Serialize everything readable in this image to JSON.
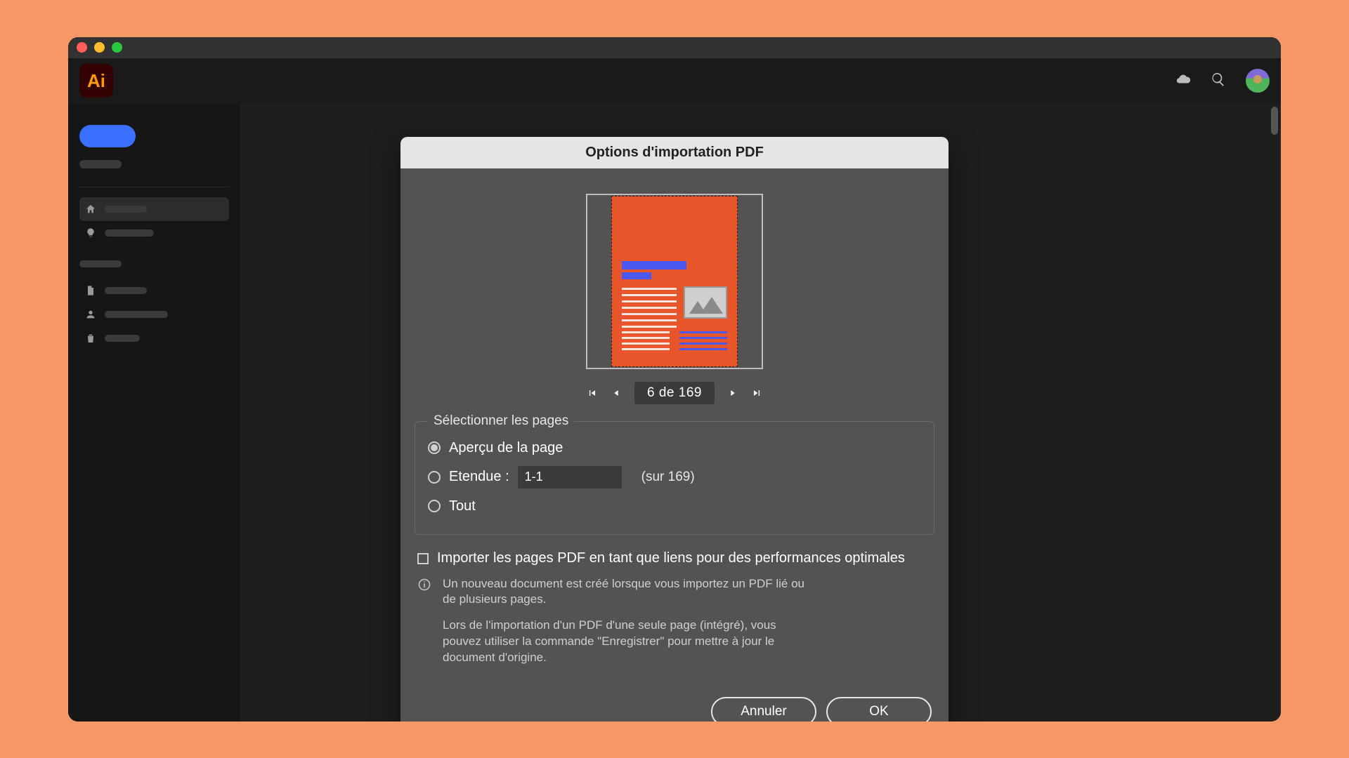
{
  "app": {
    "logo_text": "Ai"
  },
  "dialog": {
    "title": "Options d'importation PDF",
    "pager": {
      "text": "6 de 169"
    },
    "section": {
      "label": "Sélectionner les pages",
      "option_preview": "Aperçu de la page",
      "option_range_label": "Etendue :",
      "range_value": "1-1",
      "range_suffix": "(sur 169)",
      "option_all": "Tout"
    },
    "checkbox_label": "Importer les pages PDF en tant que liens pour des performances optimales",
    "info": {
      "p1": "Un nouveau document est créé lorsque vous importez un PDF lié ou de plusieurs pages.",
      "p2": "Lors de l'importation d'un PDF d'une seule page (intégré), vous pouvez utiliser la commande \"Enregistrer\" pour mettre à jour le document d'origine."
    },
    "buttons": {
      "cancel": "Annuler",
      "ok": "OK"
    }
  }
}
